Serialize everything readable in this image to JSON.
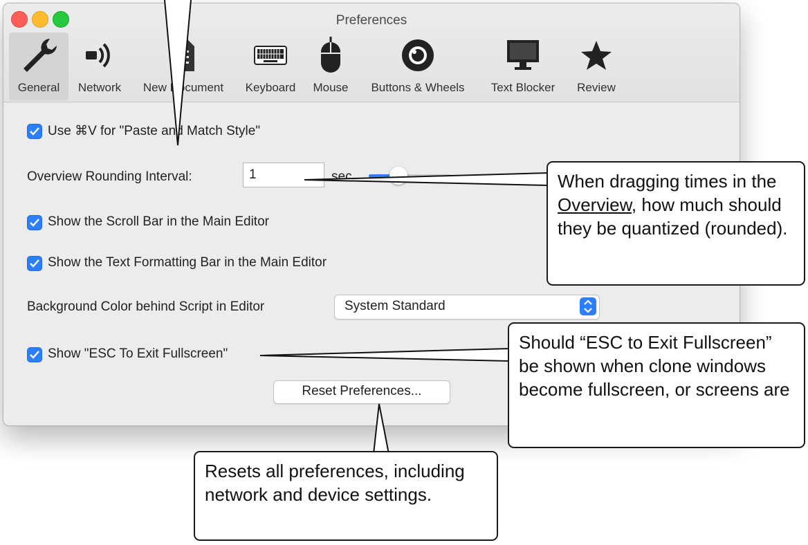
{
  "window": {
    "title": "Preferences"
  },
  "toolbar": {
    "items": [
      {
        "label": "General",
        "icon": "wrench-icon",
        "selected": true
      },
      {
        "label": "Network",
        "icon": "network-icon",
        "selected": false
      },
      {
        "label": "New Document",
        "icon": "document-icon",
        "selected": false
      },
      {
        "label": "Keyboard",
        "icon": "keyboard-icon",
        "selected": false
      },
      {
        "label": "Mouse",
        "icon": "mouse-icon",
        "selected": false
      },
      {
        "label": "Buttons & Wheels",
        "icon": "wheel-icon",
        "selected": false
      },
      {
        "label": "Text Blocker",
        "icon": "monitor-icon",
        "selected": false
      },
      {
        "label": "Review",
        "icon": "star-icon",
        "selected": false
      }
    ]
  },
  "general": {
    "paste_match_style": {
      "label": "Use ⌘V for \"Paste and Match Style\"",
      "checked": true
    },
    "rounding_interval": {
      "label": "Overview Rounding Interval:",
      "value": "1",
      "unit": "sec"
    },
    "scroll_bar": {
      "label": "Show the Scroll Bar in the Main Editor",
      "checked": true
    },
    "formatting_bar": {
      "label": "Show the Text Formatting Bar in the Main Editor",
      "checked": true
    },
    "background_color": {
      "label": "Background Color behind Script in Editor",
      "selected": "System Standard"
    },
    "esc_fullscreen": {
      "label": "Show \"ESC To Exit Fullscreen\"",
      "checked": true
    },
    "reset_button": "Reset Preferences..."
  },
  "callouts": {
    "rounding_pre": "When dragging times in the ",
    "rounding_link": "Overview",
    "rounding_post": ", how much should they be quantized (rounded).",
    "esc": "Should “ESC to Exit Fullscreen” be shown when clone windows become fullscreen, or screens are",
    "reset": "Resets all preferences, including network and device settings."
  },
  "colors": {
    "accent": "#2d7ff9",
    "window_bg": "#ececec",
    "callout_border": "#1a1a1a"
  }
}
